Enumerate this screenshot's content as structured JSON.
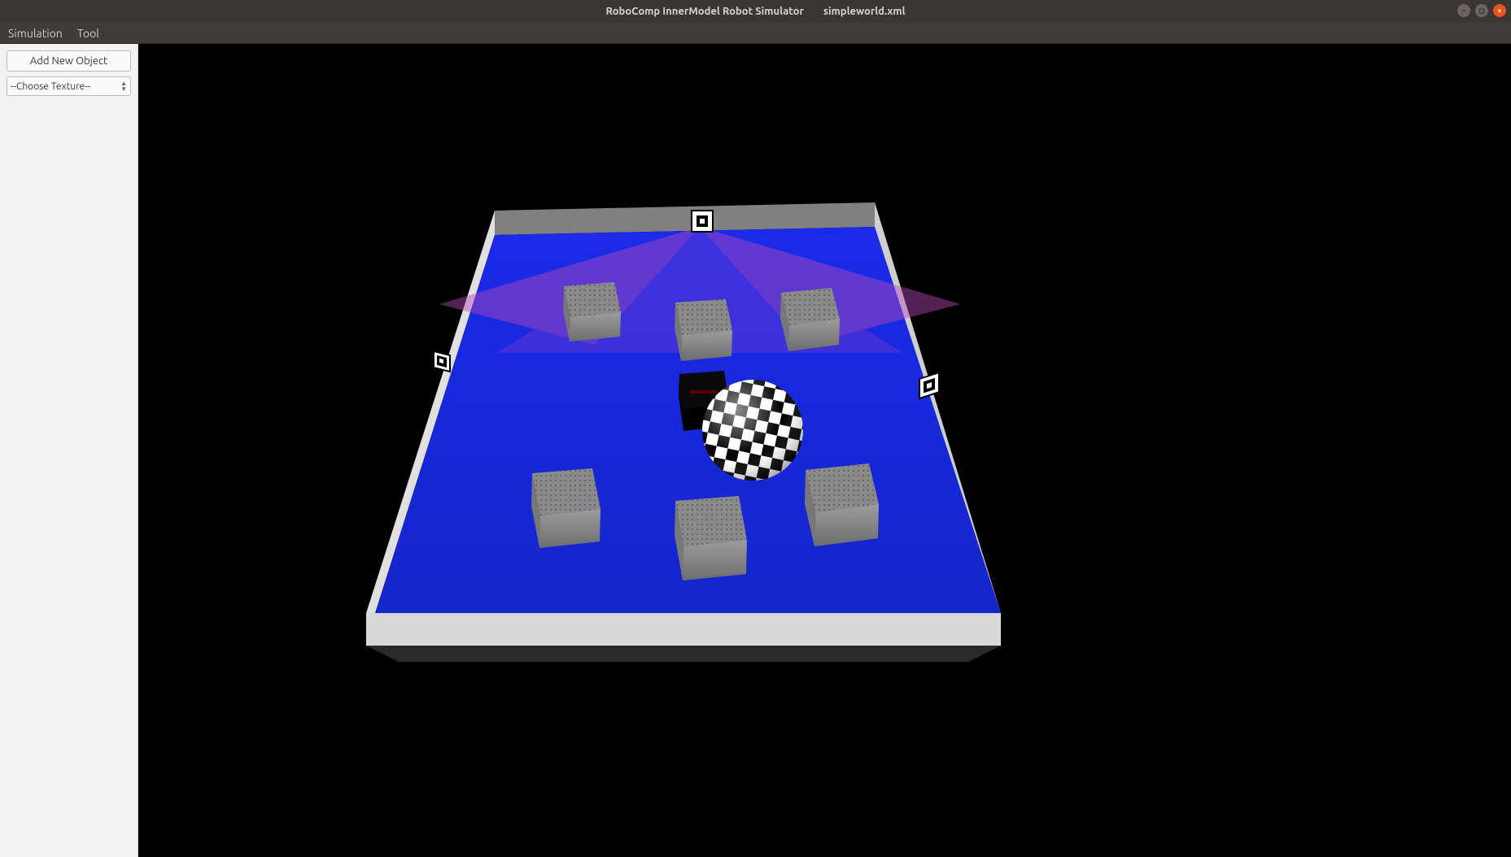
{
  "window": {
    "title_app": "RoboComp InnerModel Robot Simulator",
    "title_file": "simpleworld.xml"
  },
  "menu": {
    "simulation": "Simulation",
    "tool": "Tool"
  },
  "sidebar": {
    "add_object_label": "Add New Object",
    "texture_select_label": "--Choose Texture--"
  },
  "scene": {
    "floor_color": "#1a2adf",
    "wall_color": "#dcdcdc",
    "wall_top_color": "#808080",
    "light_cones_color": "#b94bb9",
    "boxes": 6,
    "sphere_texture": "checkerboard",
    "robot_color": "#000000",
    "markers": 3
  }
}
